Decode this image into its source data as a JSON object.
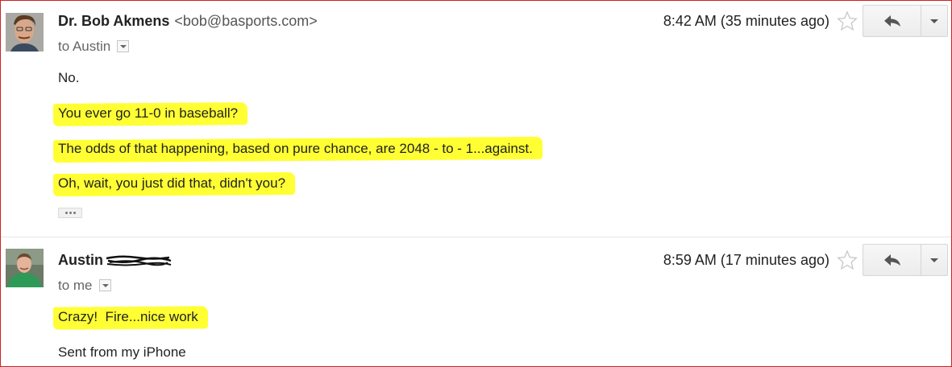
{
  "messages": [
    {
      "sender_name": "Dr. Bob Akmens",
      "sender_email": "<bob@basports.com>",
      "recipient": "to Austin",
      "time": "8:42 AM (35 minutes ago)",
      "body": [
        "No.",
        "You ever go 11-0 in baseball?",
        "The odds of that happening, based on pure chance, are 2048 - to - 1...against.",
        "Oh, wait, you just did that, didn't you?"
      ]
    },
    {
      "sender_name": "Austin",
      "recipient": "to me",
      "time": "8:59 AM (17 minutes ago)",
      "body": [
        "Crazy!  Fire...nice work",
        "Sent from my iPhone"
      ]
    }
  ],
  "icons": {
    "star": "star-outline-icon",
    "reply": "reply-arrow-icon",
    "more": "chevron-down-icon",
    "trimmed": "ellipsis-icon"
  },
  "colors": {
    "highlight": "#ffff33",
    "frame_border": "#cc2222"
  }
}
